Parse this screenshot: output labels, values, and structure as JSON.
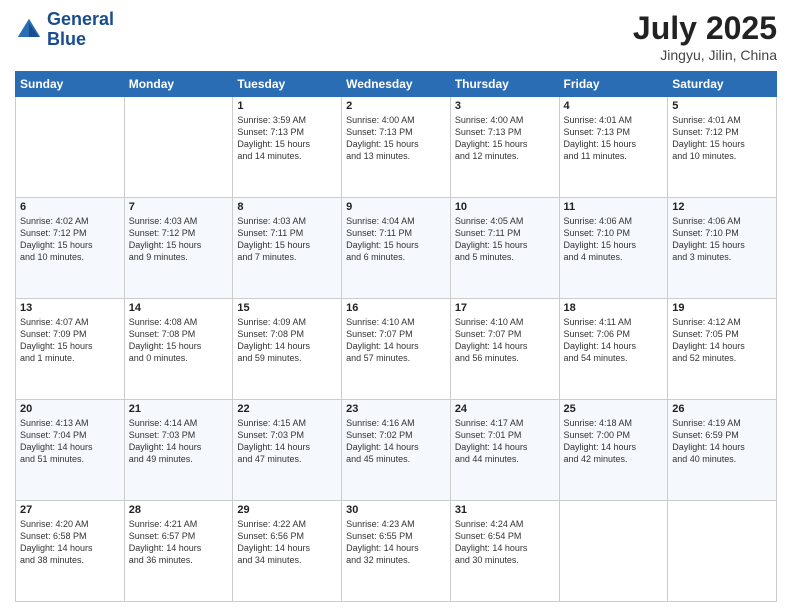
{
  "header": {
    "logo_line1": "General",
    "logo_line2": "Blue",
    "month_year": "July 2025",
    "location": "Jingyu, Jilin, China"
  },
  "weekdays": [
    "Sunday",
    "Monday",
    "Tuesday",
    "Wednesday",
    "Thursday",
    "Friday",
    "Saturday"
  ],
  "weeks": [
    [
      {
        "day": "",
        "text": ""
      },
      {
        "day": "",
        "text": ""
      },
      {
        "day": "1",
        "text": "Sunrise: 3:59 AM\nSunset: 7:13 PM\nDaylight: 15 hours\nand 14 minutes."
      },
      {
        "day": "2",
        "text": "Sunrise: 4:00 AM\nSunset: 7:13 PM\nDaylight: 15 hours\nand 13 minutes."
      },
      {
        "day": "3",
        "text": "Sunrise: 4:00 AM\nSunset: 7:13 PM\nDaylight: 15 hours\nand 12 minutes."
      },
      {
        "day": "4",
        "text": "Sunrise: 4:01 AM\nSunset: 7:13 PM\nDaylight: 15 hours\nand 11 minutes."
      },
      {
        "day": "5",
        "text": "Sunrise: 4:01 AM\nSunset: 7:12 PM\nDaylight: 15 hours\nand 10 minutes."
      }
    ],
    [
      {
        "day": "6",
        "text": "Sunrise: 4:02 AM\nSunset: 7:12 PM\nDaylight: 15 hours\nand 10 minutes."
      },
      {
        "day": "7",
        "text": "Sunrise: 4:03 AM\nSunset: 7:12 PM\nDaylight: 15 hours\nand 9 minutes."
      },
      {
        "day": "8",
        "text": "Sunrise: 4:03 AM\nSunset: 7:11 PM\nDaylight: 15 hours\nand 7 minutes."
      },
      {
        "day": "9",
        "text": "Sunrise: 4:04 AM\nSunset: 7:11 PM\nDaylight: 15 hours\nand 6 minutes."
      },
      {
        "day": "10",
        "text": "Sunrise: 4:05 AM\nSunset: 7:11 PM\nDaylight: 15 hours\nand 5 minutes."
      },
      {
        "day": "11",
        "text": "Sunrise: 4:06 AM\nSunset: 7:10 PM\nDaylight: 15 hours\nand 4 minutes."
      },
      {
        "day": "12",
        "text": "Sunrise: 4:06 AM\nSunset: 7:10 PM\nDaylight: 15 hours\nand 3 minutes."
      }
    ],
    [
      {
        "day": "13",
        "text": "Sunrise: 4:07 AM\nSunset: 7:09 PM\nDaylight: 15 hours\nand 1 minute."
      },
      {
        "day": "14",
        "text": "Sunrise: 4:08 AM\nSunset: 7:08 PM\nDaylight: 15 hours\nand 0 minutes."
      },
      {
        "day": "15",
        "text": "Sunrise: 4:09 AM\nSunset: 7:08 PM\nDaylight: 14 hours\nand 59 minutes."
      },
      {
        "day": "16",
        "text": "Sunrise: 4:10 AM\nSunset: 7:07 PM\nDaylight: 14 hours\nand 57 minutes."
      },
      {
        "day": "17",
        "text": "Sunrise: 4:10 AM\nSunset: 7:07 PM\nDaylight: 14 hours\nand 56 minutes."
      },
      {
        "day": "18",
        "text": "Sunrise: 4:11 AM\nSunset: 7:06 PM\nDaylight: 14 hours\nand 54 minutes."
      },
      {
        "day": "19",
        "text": "Sunrise: 4:12 AM\nSunset: 7:05 PM\nDaylight: 14 hours\nand 52 minutes."
      }
    ],
    [
      {
        "day": "20",
        "text": "Sunrise: 4:13 AM\nSunset: 7:04 PM\nDaylight: 14 hours\nand 51 minutes."
      },
      {
        "day": "21",
        "text": "Sunrise: 4:14 AM\nSunset: 7:03 PM\nDaylight: 14 hours\nand 49 minutes."
      },
      {
        "day": "22",
        "text": "Sunrise: 4:15 AM\nSunset: 7:03 PM\nDaylight: 14 hours\nand 47 minutes."
      },
      {
        "day": "23",
        "text": "Sunrise: 4:16 AM\nSunset: 7:02 PM\nDaylight: 14 hours\nand 45 minutes."
      },
      {
        "day": "24",
        "text": "Sunrise: 4:17 AM\nSunset: 7:01 PM\nDaylight: 14 hours\nand 44 minutes."
      },
      {
        "day": "25",
        "text": "Sunrise: 4:18 AM\nSunset: 7:00 PM\nDaylight: 14 hours\nand 42 minutes."
      },
      {
        "day": "26",
        "text": "Sunrise: 4:19 AM\nSunset: 6:59 PM\nDaylight: 14 hours\nand 40 minutes."
      }
    ],
    [
      {
        "day": "27",
        "text": "Sunrise: 4:20 AM\nSunset: 6:58 PM\nDaylight: 14 hours\nand 38 minutes."
      },
      {
        "day": "28",
        "text": "Sunrise: 4:21 AM\nSunset: 6:57 PM\nDaylight: 14 hours\nand 36 minutes."
      },
      {
        "day": "29",
        "text": "Sunrise: 4:22 AM\nSunset: 6:56 PM\nDaylight: 14 hours\nand 34 minutes."
      },
      {
        "day": "30",
        "text": "Sunrise: 4:23 AM\nSunset: 6:55 PM\nDaylight: 14 hours\nand 32 minutes."
      },
      {
        "day": "31",
        "text": "Sunrise: 4:24 AM\nSunset: 6:54 PM\nDaylight: 14 hours\nand 30 minutes."
      },
      {
        "day": "",
        "text": ""
      },
      {
        "day": "",
        "text": ""
      }
    ]
  ]
}
